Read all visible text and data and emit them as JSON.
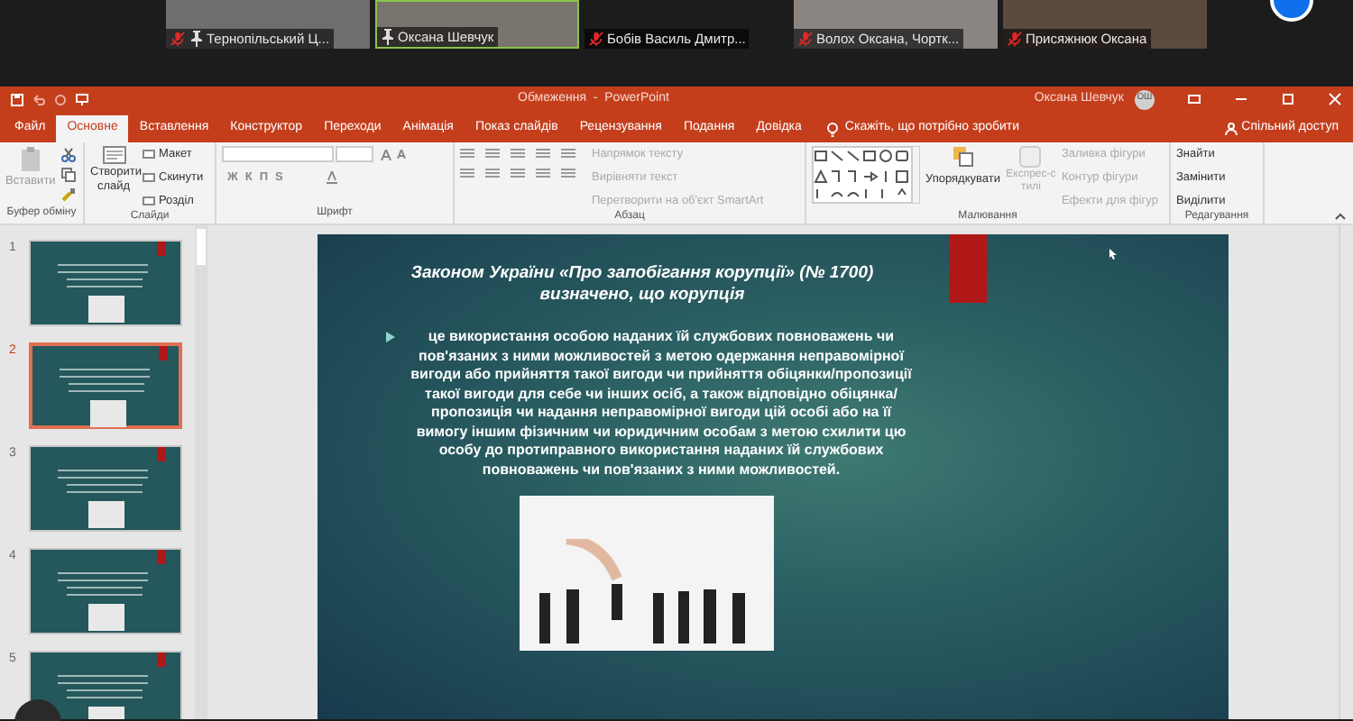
{
  "meeting": {
    "participants": [
      {
        "name": "Тернопільський Ц...",
        "muted": true,
        "pinned": true,
        "active": false
      },
      {
        "name": "Оксана Шевчук",
        "muted": false,
        "pinned": true,
        "active": true
      },
      {
        "name": "Бобів Василь Дмитр...",
        "muted": true,
        "pinned": false,
        "active": false
      },
      {
        "name": "Волох Оксана, Чортк...",
        "muted": true,
        "pinned": false,
        "active": false
      },
      {
        "name": "Присяжнюк Оксана",
        "muted": true,
        "pinned": false,
        "active": false
      }
    ]
  },
  "window": {
    "title": "Обмеження  -  PowerPoint",
    "user": "Оксана Шевчук",
    "user_initials": "ОШ"
  },
  "tabs": [
    {
      "label": "Файл",
      "selected": false
    },
    {
      "label": "Основне",
      "selected": true
    },
    {
      "label": "Вставлення",
      "selected": false
    },
    {
      "label": "Конструктор",
      "selected": false
    },
    {
      "label": "Переходи",
      "selected": false
    },
    {
      "label": "Анімація",
      "selected": false
    },
    {
      "label": "Показ слайдів",
      "selected": false
    },
    {
      "label": "Рецензування",
      "selected": false
    },
    {
      "label": "Подання",
      "selected": false
    },
    {
      "label": "Довідка",
      "selected": false
    }
  ],
  "tell_me": "Скажіть, що потрібно зробити",
  "share": "Спільний доступ",
  "ribbon": {
    "clipboard": {
      "label": "Буфер обміну",
      "paste": "Вставити"
    },
    "slides": {
      "label": "Слайди",
      "new_slide": "Створити слайд",
      "items": [
        "Макет",
        "Скинути",
        "Розділ"
      ]
    },
    "font": {
      "label": "Шрифт",
      "format": [
        "Ж",
        "К",
        "П",
        "S"
      ]
    },
    "paragraph": {
      "label": "Абзац",
      "items": [
        "Напрямок тексту",
        "Вирівняти текст",
        "Перетворити на об'єкт SmartArt"
      ]
    },
    "drawing": {
      "label": "Малювання",
      "arrange": "Упорядкувати",
      "quick_styles": "Експрес-стилі",
      "items": [
        "Заливка фігури",
        "Контур фігури",
        "Ефекти для фігур"
      ]
    },
    "editing": {
      "label": "Редагування",
      "items": [
        "Знайти",
        "Замінити",
        "Виділити"
      ]
    }
  },
  "slides": [
    {
      "number": "1",
      "selected": false
    },
    {
      "number": "2",
      "selected": true
    },
    {
      "number": "3",
      "selected": false
    },
    {
      "number": "4",
      "selected": false
    },
    {
      "number": "5",
      "selected": false
    }
  ],
  "slide": {
    "title": "Законом України «Про запобігання корупції» (№ 1700) визначено, що корупція",
    "bullet": "це використання особою наданих їй службових повноважень чи пов'язаних з ними можливостей з метою одержання неправомірної вигоди або прийняття такої вигоди чи прийняття обіцянки/пропозиції такої вигоди для себе чи інших осіб, а також відповідно обіцянка/пропозиція чи надання неправомірної вигоди цій особі або на її вимогу іншим фізичним чи юридичним особам з метою схилити цю особу до протиправного використання наданих їй службових повноважень чи пов'язаних з ними можливостей."
  }
}
